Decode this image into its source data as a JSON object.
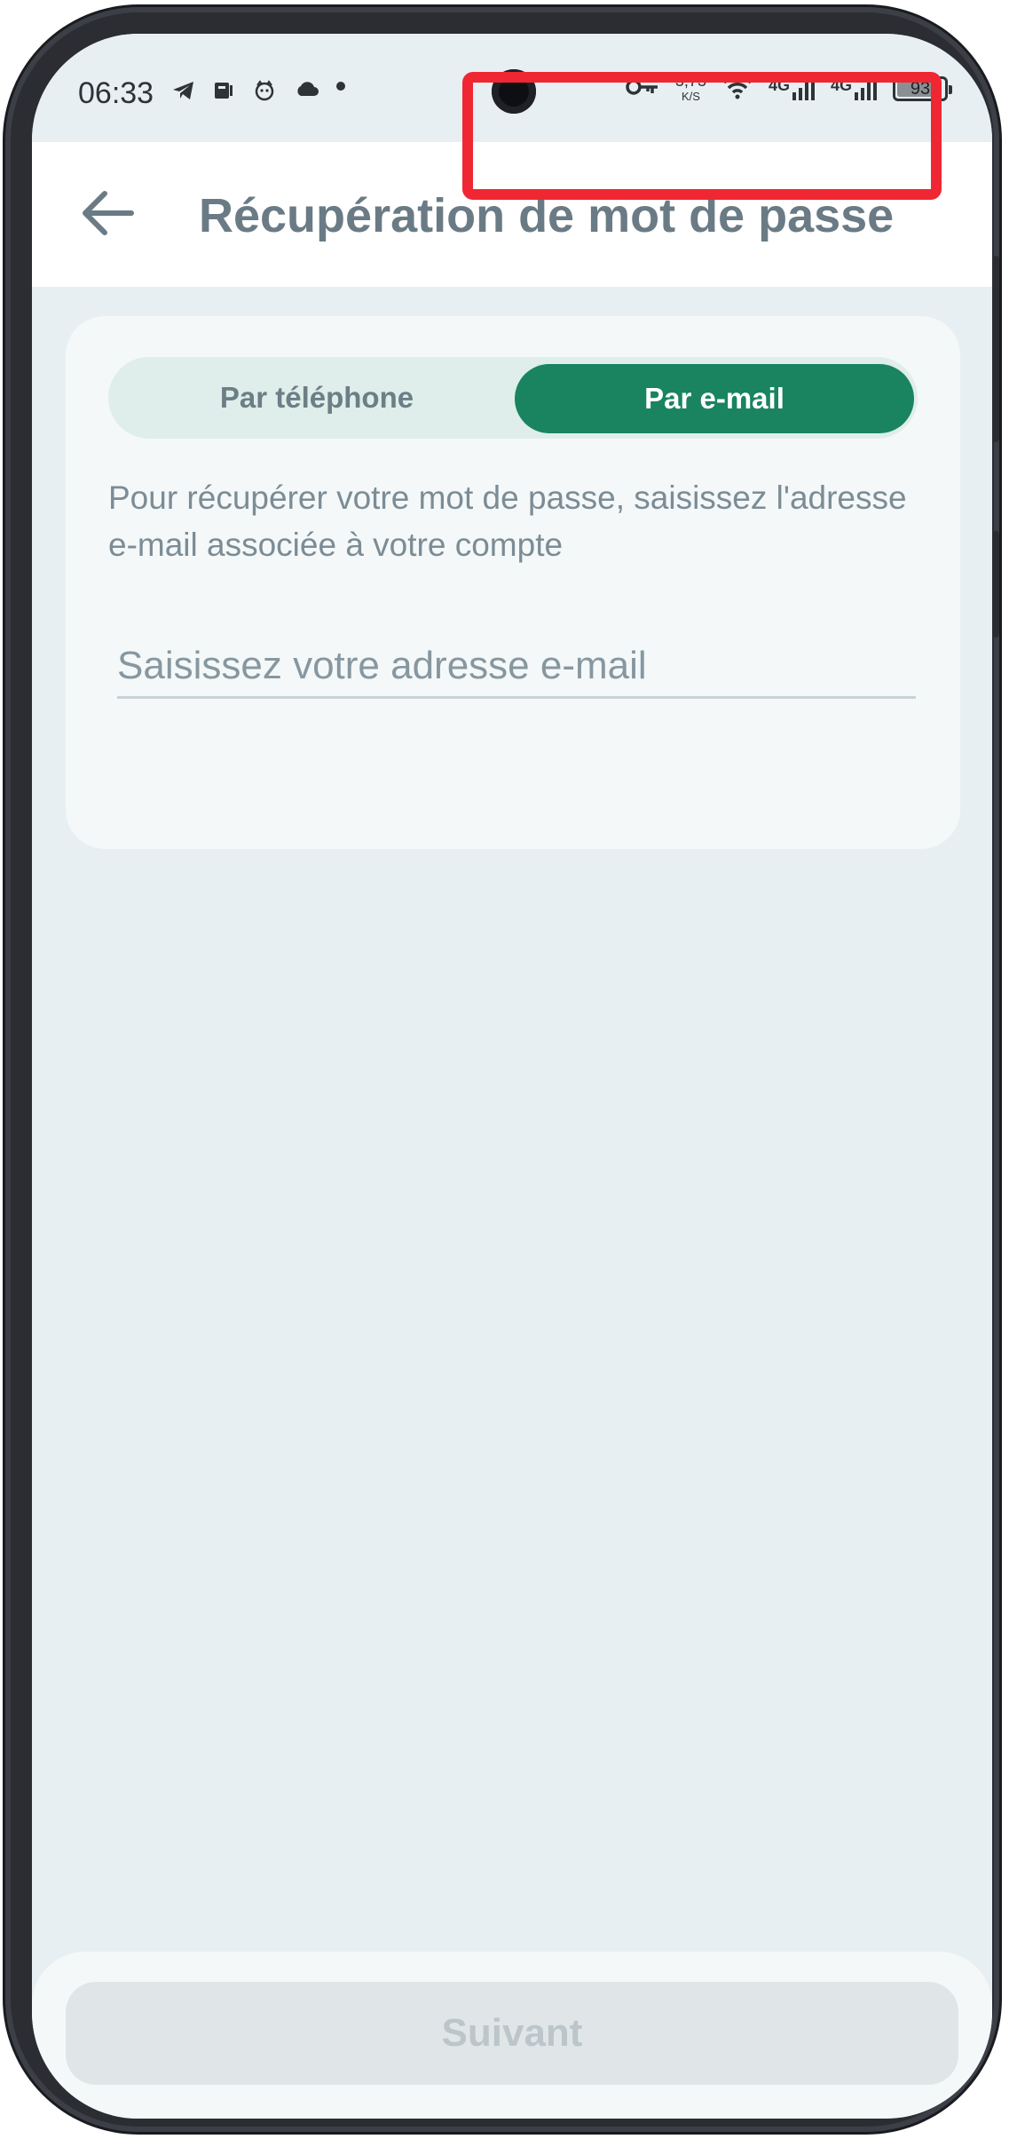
{
  "status_bar": {
    "time": "06:33",
    "net_speed_value": "3,73",
    "net_speed_unit": "K/S",
    "signal1_label": "4G",
    "signal2_label": "4G",
    "battery_level": "93",
    "battery_fraction": 0.93
  },
  "header": {
    "title": "Récupération de mot de passe"
  },
  "tabs": {
    "phone_label": "Par téléphone",
    "email_label": "Par e-mail",
    "selected": "email"
  },
  "form": {
    "description": "Pour récupérer votre mot de passe, saisissez l'adresse e-mail associée à votre compte",
    "email_placeholder": "Saisissez votre adresse e-mail",
    "email_value": ""
  },
  "footer": {
    "next_label": "Suivant"
  },
  "colors": {
    "accent": "#19845f",
    "highlight": "#ef2733",
    "title_text": "#6a7b85"
  }
}
